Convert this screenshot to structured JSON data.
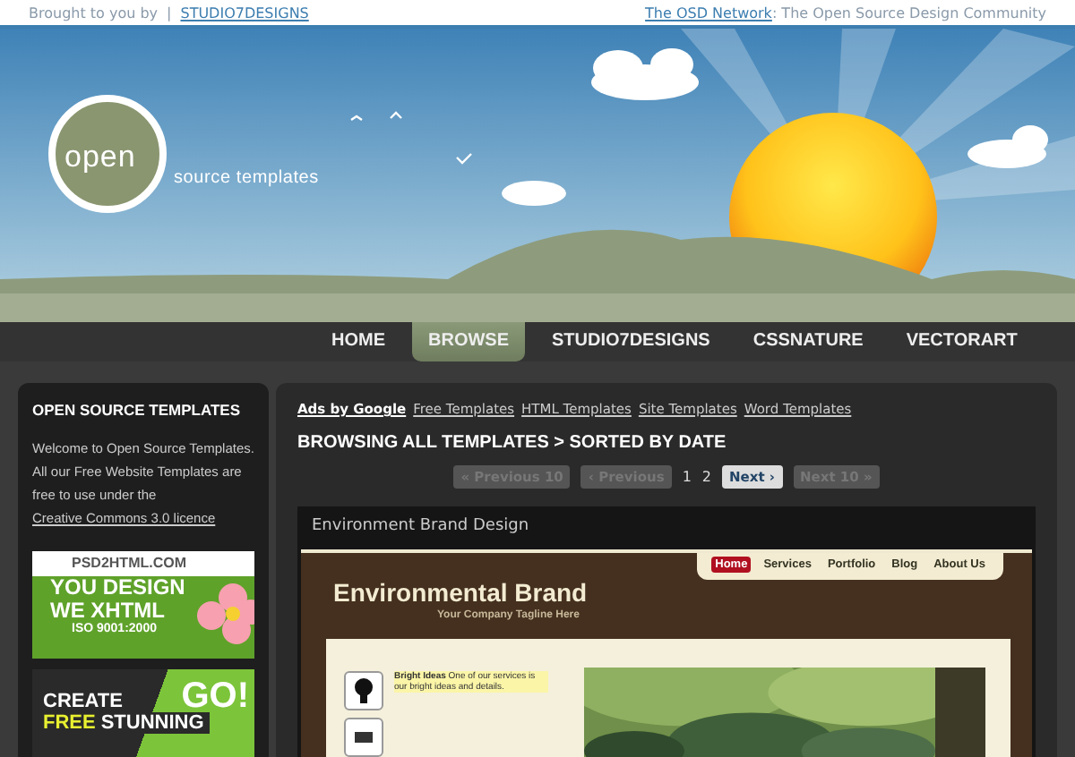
{
  "top_bar": {
    "credit": "Brought to you by",
    "separator": "|",
    "credit_link": "STUDIO7DESIGNS",
    "network_link": "The OSD Network",
    "network_text": ": The Open Source Design Community"
  },
  "logo": {
    "word": "open",
    "tagline": "source templates"
  },
  "nav": [
    {
      "label": "HOME",
      "selected": false
    },
    {
      "label": "BROWSE",
      "selected": true
    },
    {
      "label": "STUDIO7DESIGNS",
      "selected": false
    },
    {
      "label": "CSSNATURE",
      "selected": false
    },
    {
      "label": "VECTORART",
      "selected": false
    }
  ],
  "sidebar": {
    "title": "OPEN SOURCE TEMPLATES",
    "text": "Welcome to Open Source Templates. All our Free Website Templates are free to use under the ",
    "link": "Creative Commons 3.0 licence",
    "banners": [
      {
        "kind": "xhtml",
        "lines": [
          "PSD2HTML.COM",
          "YOU DESIGN",
          "WE XHTML",
          "ISO 9001:2000"
        ]
      },
      {
        "kind": "go",
        "lines": [
          "CREATE",
          "FREE",
          "STUNNING",
          "GO!"
        ]
      }
    ]
  },
  "ads": {
    "label": "Ads by Google",
    "links": [
      "Free Templates",
      "HTML Templates",
      "Site Templates",
      "Word Templates"
    ]
  },
  "heading": "BROWSING ALL TEMPLATES > SORTED BY DATE",
  "pagination": [
    {
      "kind": "button",
      "label": "« Previous 10",
      "disabled": true
    },
    {
      "kind": "button",
      "label": "‹ Previous",
      "disabled": true
    },
    {
      "kind": "page",
      "label": "1"
    },
    {
      "kind": "page",
      "label": "2"
    },
    {
      "kind": "button",
      "label": "Next ›",
      "disabled": false
    },
    {
      "kind": "button",
      "label": "Next 10 »",
      "disabled": true
    }
  ],
  "template": {
    "title": "Environment Brand Design",
    "preview": {
      "brand": "Environmental Brand",
      "tagline": "Your Company Tagline Here",
      "nav": [
        {
          "label": "Home",
          "selected": true
        },
        {
          "label": "Services",
          "selected": false
        },
        {
          "label": "Portfolio",
          "selected": false
        },
        {
          "label": "Blog",
          "selected": false
        },
        {
          "label": "About Us",
          "selected": false
        }
      ],
      "feature_title": "Bright Ideas",
      "feature_text": " One of our services is our bright ideas and details."
    }
  }
}
